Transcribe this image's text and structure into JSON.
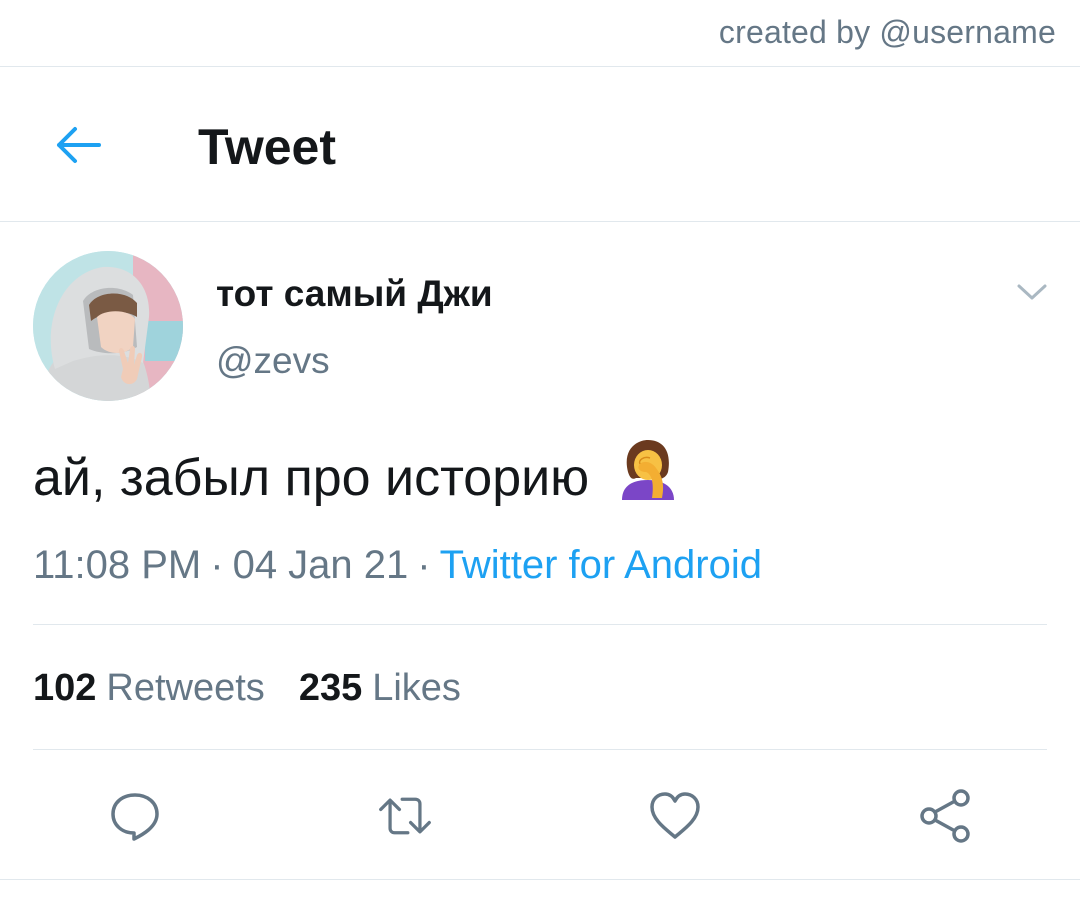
{
  "watermark": "created by @username",
  "header": {
    "title": "Tweet",
    "back_icon": "arrow-left-icon"
  },
  "tweet": {
    "display_name": "тот самый Джи",
    "handle": "@zevs",
    "text": "ай, забыл про историю",
    "emoji": "face-palm-emoji",
    "time": "11:08 PM",
    "date": "04 Jan 21",
    "separator": "·",
    "source": "Twitter for Android",
    "retweets_count": "102",
    "retweets_label": "Retweets",
    "likes_count": "235",
    "likes_label": "Likes"
  },
  "actions": [
    {
      "icon": "reply-icon"
    },
    {
      "icon": "retweet-icon"
    },
    {
      "icon": "like-icon"
    },
    {
      "icon": "share-icon"
    }
  ],
  "colors": {
    "accent": "#1da1f2",
    "text": "#14171a",
    "secondary": "#657786",
    "divider": "#e1e8ed"
  }
}
